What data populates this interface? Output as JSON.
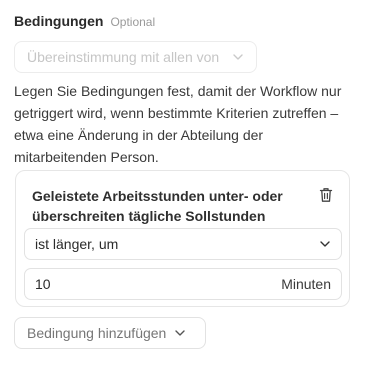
{
  "section": {
    "title": "Bedingungen",
    "optional": "Optional"
  },
  "match_select": {
    "value": "Übereinstimmung mit allen von"
  },
  "description": "Legen Sie Bedingungen fest, damit der Workflow nur getriggert wird, wenn bestimmte Kriterien zutreffen – etwa eine Änderung in der Abteilung der mitarbeitenden Person.",
  "condition": {
    "title": "Geleistete Arbeitsstunden unter- oder überschreiten tägliche Sollstunden",
    "operator": "ist länger, um",
    "value": "10",
    "unit": "Minuten"
  },
  "add_button": {
    "label": "Bedingung hinzufügen"
  },
  "icons": {
    "chevron": "chevron-down-icon",
    "trash": "trash-icon"
  },
  "colors": {
    "text": "#2b2b2b",
    "muted": "#9a9a9a",
    "disabled": "#c6c6c6",
    "border": "#e2e2e2"
  }
}
